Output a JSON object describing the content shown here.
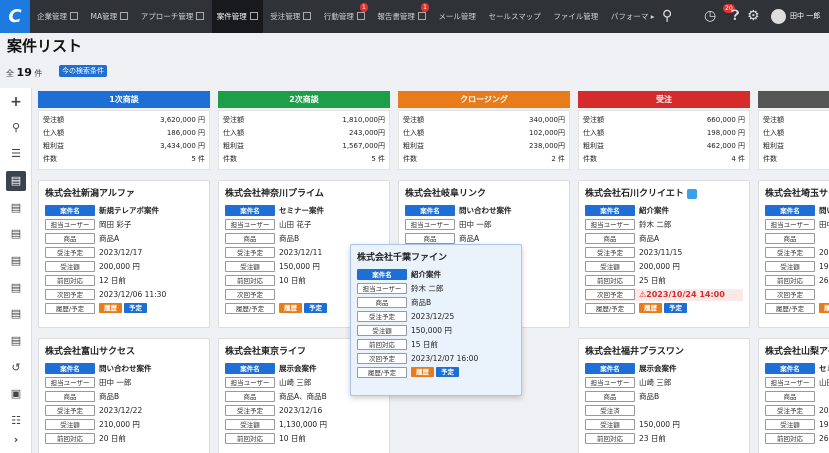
{
  "topbar": {
    "logo": "C",
    "tabs": [
      {
        "label": "企業管理"
      },
      {
        "label": "MA管理"
      },
      {
        "label": "アプローチ管理"
      },
      {
        "label": "案件管理",
        "active": true
      },
      {
        "label": "受注管理"
      },
      {
        "label": "行動管理",
        "badge": "1"
      },
      {
        "label": "報告書管理",
        "badge": "1"
      },
      {
        "label": "メール管理"
      },
      {
        "label": "セールスマップ"
      },
      {
        "label": "ファイル管理"
      },
      {
        "label": "パフォーマ"
      }
    ],
    "notification_badge": "20",
    "user_name": "田中 一郎",
    "icons": [
      "search-icon",
      "clock-icon",
      "help-icon",
      "gear-icon"
    ]
  },
  "page": {
    "title": "案件リスト",
    "count_prefix": "全",
    "count": "19",
    "count_suffix": "件",
    "filter_button": "今の検索条件"
  },
  "sidebar": {
    "icons": [
      "plus-icon",
      "search-icon",
      "list-icon",
      "board-icon",
      "doc-icon",
      "doc-icon",
      "doc-icon",
      "doc-icon",
      "doc-icon",
      "doc-icon",
      "undo-icon",
      "calendar-icon",
      "table-icon",
      "chevron-right-icon"
    ]
  },
  "labels": {
    "sales": "受注額",
    "purchase": "仕入額",
    "gross": "粗利益",
    "count": "件数",
    "deal_name": "案件名",
    "owner": "担当ユーザー",
    "product": "商品",
    "scheduled": "受注予定",
    "amount": "受注額",
    "prev": "前回対応",
    "next": "次回予定",
    "history": "履歴/予定",
    "hist_tag": "履歴",
    "plan_tag": "予定",
    "done": "受注済"
  },
  "stages": [
    {
      "name": "1次商談",
      "color": "#1d6fd6",
      "sales": "3,620,000 円",
      "purchase": "186,000 円",
      "gross": "3,434,000 円",
      "count": "5 件"
    },
    {
      "name": "2次商談",
      "color": "#1f9e4a",
      "sales": "1,810,000円",
      "purchase": "243,000円",
      "gross": "1,567,000円",
      "count": "5 件"
    },
    {
      "name": "クロージング",
      "color": "#e87b1a",
      "sales": "340,000円",
      "purchase": "102,000円",
      "gross": "238,000円",
      "count": "2 件"
    },
    {
      "name": "受注",
      "color": "#d62b2b",
      "sales": "660,000 円",
      "purchase": "198,000 円",
      "gross": "462,000 円",
      "count": "4 件"
    },
    {
      "name": "",
      "color": "#555555",
      "sales": "",
      "purchase": "",
      "gross": "",
      "count": ""
    }
  ],
  "cards": {
    "c1": {
      "company": "株式会社新潟アルファ",
      "deal": "新規テレアポ案件",
      "owner": "岡田 彩子",
      "product": "商品A",
      "scheduled": "2023/12/17",
      "amount": "200,000 円",
      "prev": "12 日前",
      "next": "2023/12/06 11:30"
    },
    "c2": {
      "company": "株式会社富山サクセス",
      "deal": "問い合わせ案件",
      "owner": "田中 一郎",
      "product": "商品B",
      "scheduled": "2023/12/22",
      "amount": "210,000 円",
      "prev": "20 日前"
    },
    "c3": {
      "company": "株式会社神奈川プライム",
      "deal": "セミナー案件",
      "owner": "山田 花子",
      "product": "商品B",
      "scheduled": "2023/12/11",
      "amount": "150,000 円",
      "prev": "10 日前",
      "next": ""
    },
    "c4": {
      "company": "株式会社東京ライフ",
      "deal": "展示会案件",
      "owner": "山崎 三郎",
      "product": "商品A、商品B",
      "scheduled": "2023/12/16",
      "amount": "1,130,000 円",
      "prev": "10 日前"
    },
    "c5": {
      "company": "株式会社岐阜リンク",
      "deal": "問い合わせ案件",
      "owner": "田中 一郎",
      "product": "商品A"
    },
    "c6": {
      "company": "株式会社千葉ファイン",
      "deal": "紹介案件",
      "owner": "鈴木 二郎",
      "product": "商品B",
      "scheduled": "2023/12/25",
      "amount": "150,000 円",
      "prev": "15 日前",
      "next": "2023/12/07 16:00"
    },
    "c7": {
      "company": "株式会社石川クリイエト",
      "deal": "紹介案件",
      "owner": "鈴木 二郎",
      "product": "商品A",
      "scheduled": "2023/11/15",
      "amount": "200,000 円",
      "prev": "25 日前",
      "next": "2023/10/24 14:00"
    },
    "c8": {
      "company": "株式会社福井プラスワン",
      "deal": "展示会案件",
      "owner": "山崎 三郎",
      "product": "商品B",
      "amount": "150,000 円",
      "prev": "23 日前"
    },
    "c9": {
      "company": "株式会社埼玉サクセス",
      "deal": "問い",
      "owner": "田中",
      "scheduled": "202",
      "amount": "190",
      "prev": "26"
    },
    "c10": {
      "company": "株式会社山梨アイ",
      "deal": "セミ",
      "owner": "山田",
      "scheduled": "202",
      "amount": "190",
      "prev": "26"
    }
  }
}
